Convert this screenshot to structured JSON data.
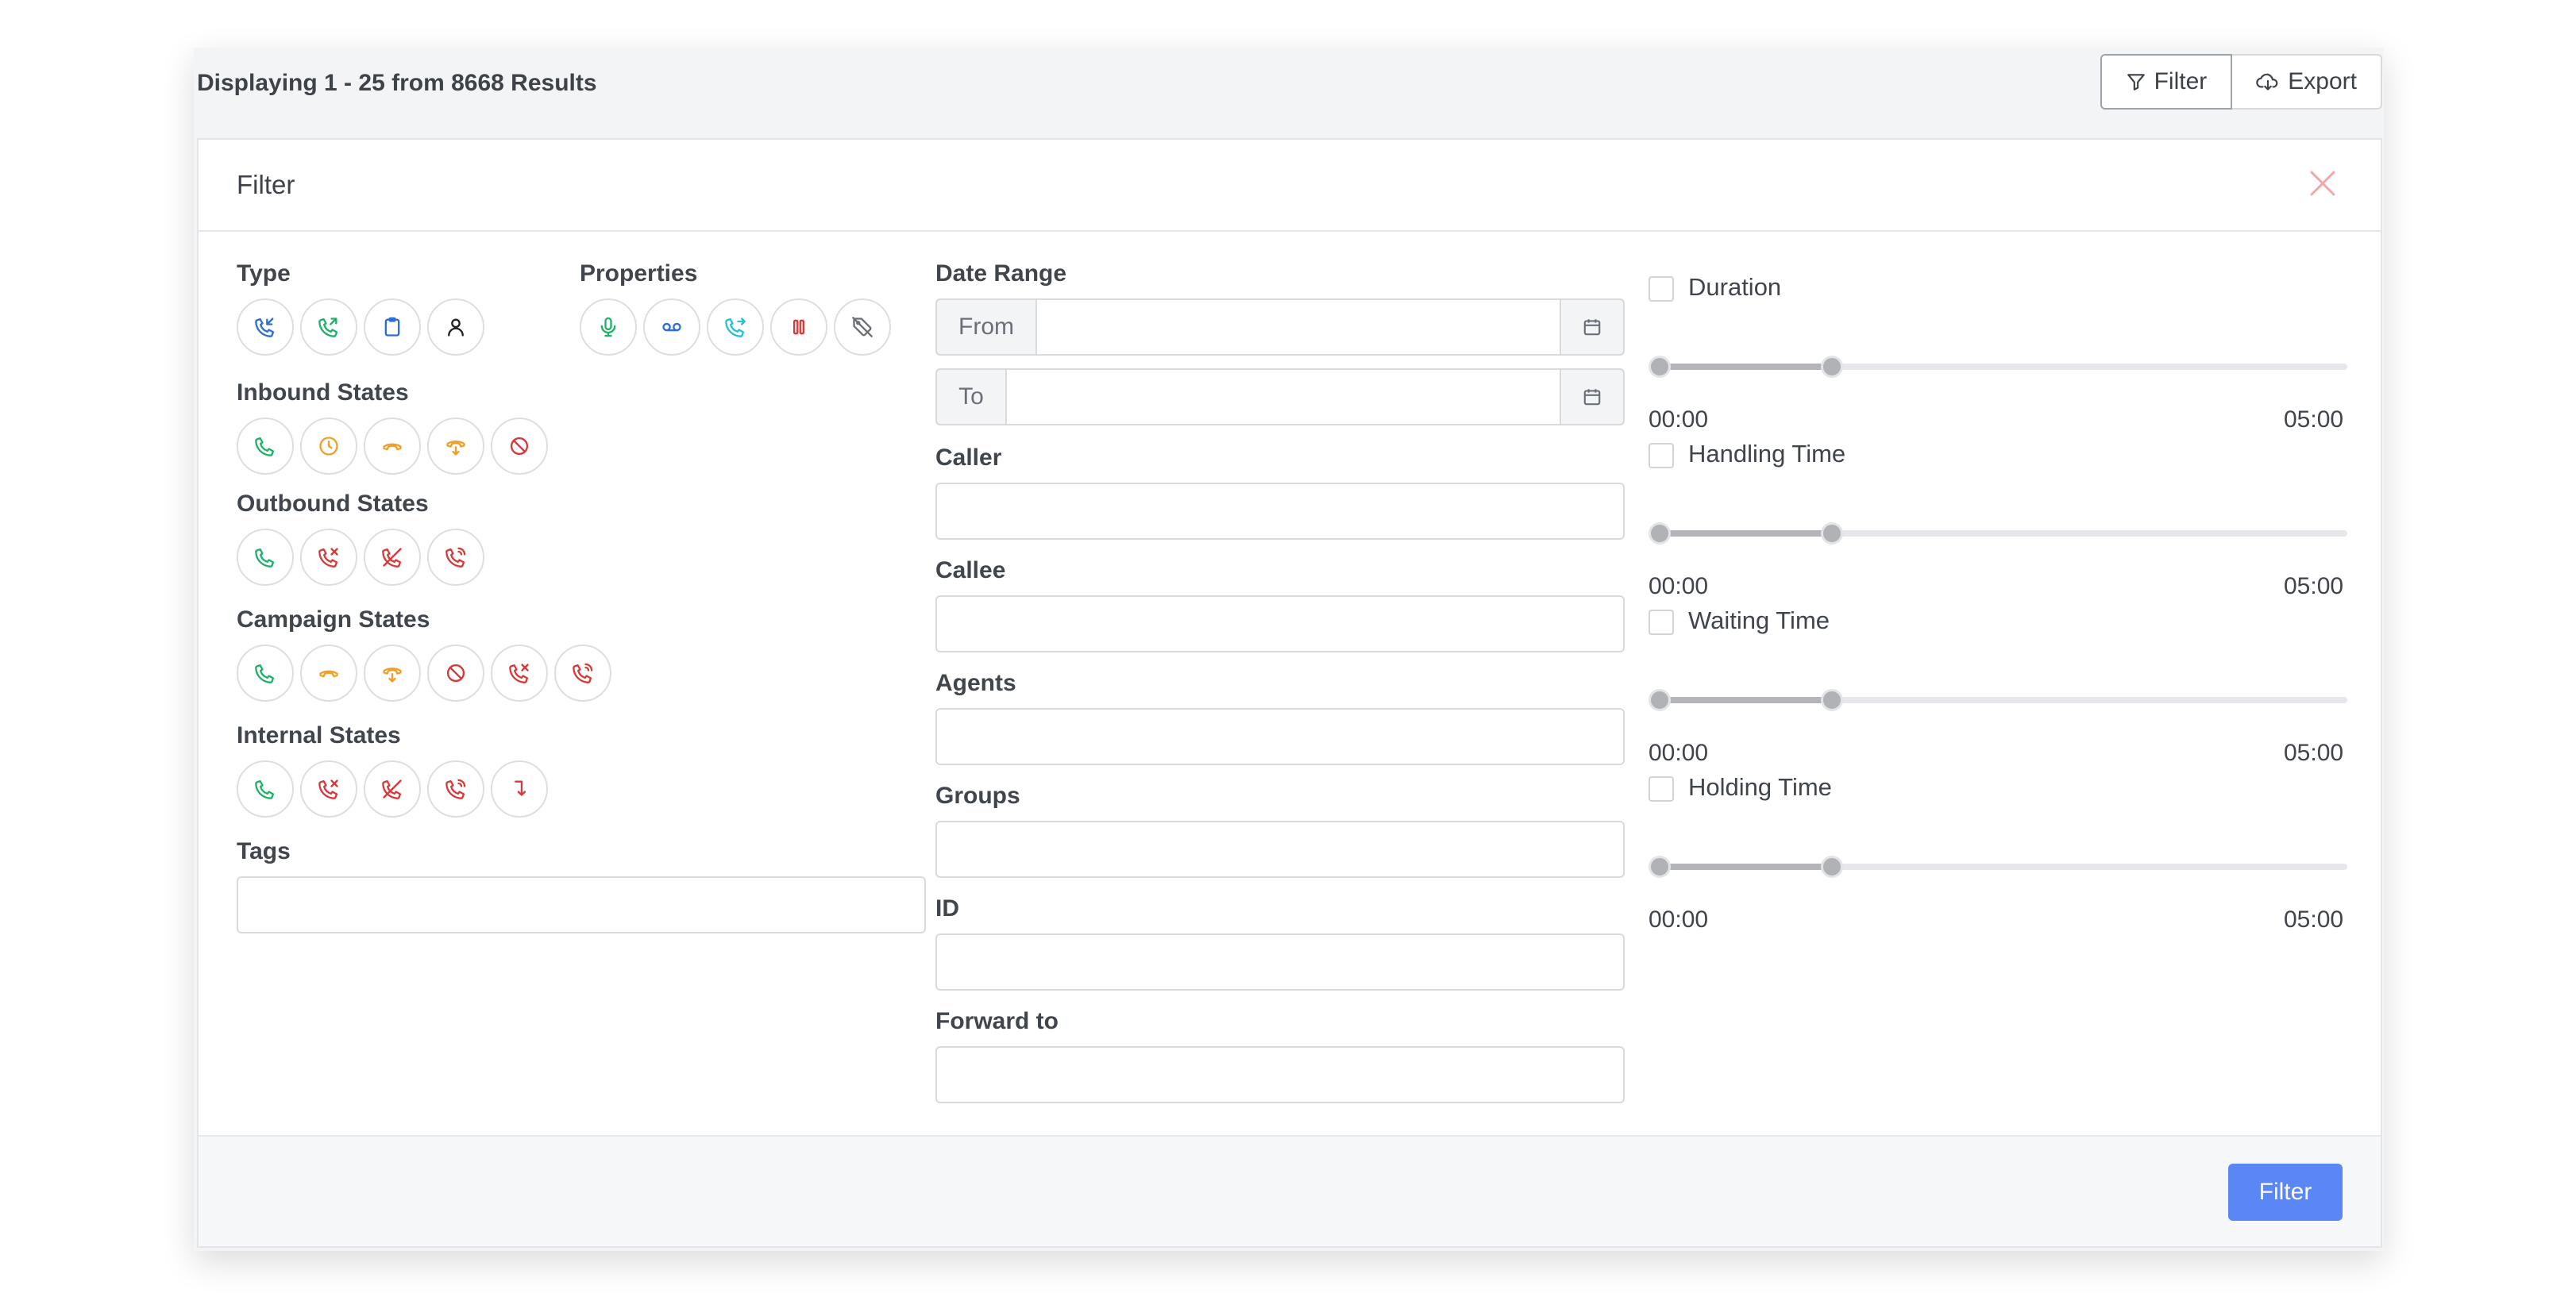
{
  "results_text": "Displaying 1 - 25 from 8668 Results",
  "toolbar": {
    "filter_label": "Filter",
    "export_label": "Export"
  },
  "panel": {
    "title": "Filter",
    "submit_label": "Filter"
  },
  "sections": {
    "type": "Type",
    "properties": "Properties",
    "inbound": "Inbound States",
    "outbound": "Outbound States",
    "campaign": "Campaign States",
    "internal": "Internal States",
    "tags": "Tags"
  },
  "date_range": {
    "label": "Date Range",
    "from": "From",
    "to": "To"
  },
  "fields": {
    "caller": "Caller",
    "callee": "Callee",
    "agents": "Agents",
    "groups": "Groups",
    "id": "ID",
    "forward_to": "Forward to"
  },
  "ranges": [
    {
      "label": "Duration",
      "min": "00:00",
      "max": "05:00",
      "low": 0.0,
      "high": 0.25
    },
    {
      "label": "Handling Time",
      "min": "00:00",
      "max": "05:00",
      "low": 0.0,
      "high": 0.25
    },
    {
      "label": "Waiting Time",
      "min": "00:00",
      "max": "05:00",
      "low": 0.0,
      "high": 0.25
    },
    {
      "label": "Holding Time",
      "min": "00:00",
      "max": "05:00",
      "low": 0.0,
      "high": 0.25
    }
  ],
  "colors": {
    "accent": "#5b86f5",
    "green": "#22b06b",
    "orange": "#f0a028",
    "red": "#d83a3a",
    "blue": "#2f6fd1",
    "teal": "#27c0d8",
    "close": "#f0a8a8"
  }
}
